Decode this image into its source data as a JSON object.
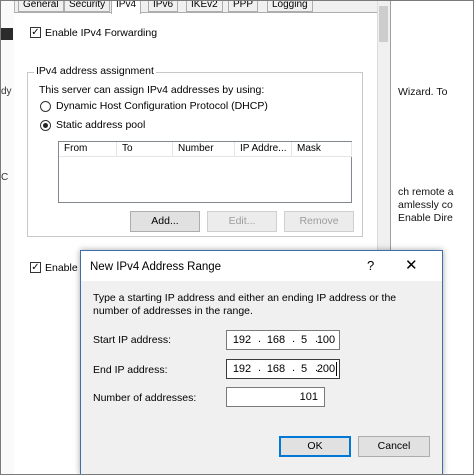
{
  "tabs": [
    {
      "label": "General",
      "active": false
    },
    {
      "label": "Security",
      "active": false
    },
    {
      "label": "IPv4",
      "active": true
    },
    {
      "label": "IPv6",
      "active": false
    },
    {
      "label": "IKEv2",
      "active": false
    },
    {
      "label": "PPP",
      "active": false
    },
    {
      "label": "Logging",
      "active": false
    }
  ],
  "ipv4": {
    "enable_forwarding_label": "Enable IPv4 Forwarding",
    "enable_forwarding_checked": true,
    "group_title": "IPv4 address assignment",
    "group_description": "This server can assign IPv4 addresses by using:",
    "dhcp_label": "Dynamic Host Configuration Protocol (DHCP)",
    "static_label": "Static address pool",
    "static_selected": true,
    "columns": [
      "From",
      "To",
      "Number",
      "IP Addre...",
      "Mask"
    ],
    "add_button": "Add...",
    "edit_button": "Edit...",
    "remove_button": "Remove",
    "enable_second_label": "Enable I",
    "enable_second_checked": true
  },
  "background": {
    "right_lines": [
      "Wizard. To",
      "ch remote a",
      "amlessly co",
      "Enable Dire"
    ],
    "left_fragments": [
      "dy",
      "C"
    ]
  },
  "dialog": {
    "title": "New IPv4 Address Range",
    "help": "?",
    "close": "✕",
    "description": "Type a starting IP address and either an ending IP address or the number of addresses in the range.",
    "start_label": "Start IP address:",
    "start_ip": [
      "192",
      "168",
      "5",
      "100"
    ],
    "end_label": "End IP address:",
    "end_ip": [
      "192",
      "168",
      "5",
      "200"
    ],
    "count_label": "Number of addresses:",
    "count_value": "101",
    "ok_button": "OK",
    "cancel_button": "Cancel"
  }
}
